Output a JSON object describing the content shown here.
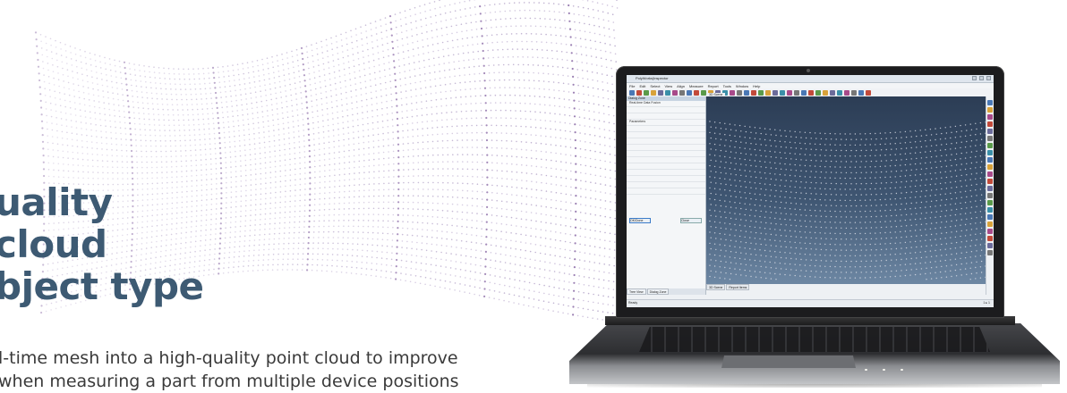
{
  "headline": {
    "line1": "uality",
    "line2": "cloud",
    "line3": "bject type"
  },
  "subtext": {
    "line1": "l-time mesh into a high-quality point cloud to improve",
    "line2": "when measuring a part from multiple device positions"
  },
  "colors": {
    "headline": "#3d5a73",
    "dots_purple": "#8a6aa6",
    "dots_light": "#c9bcd8",
    "viewport_top": "#2c3d55",
    "viewport_bottom": "#6d87a3"
  },
  "app": {
    "title": "PolyWorks|Inspector",
    "menu": [
      "File",
      "Edit",
      "Select",
      "View",
      "Align",
      "Measure",
      "Report",
      "Tools",
      "Window",
      "Help"
    ],
    "left_panel": {
      "header": "Dialog Zone",
      "section1": "Real-time Data Fusion",
      "section2": "Parameters",
      "button": "OK/Done",
      "cancel": "Close",
      "tabs": [
        "Tree View",
        "Dialog Zone"
      ]
    },
    "viewport_tab": "3D Scene",
    "bottom_tabs": [
      "3D Scene",
      "Report Items"
    ],
    "status_left": "Ready",
    "status_right": "1 ▸ 1"
  }
}
